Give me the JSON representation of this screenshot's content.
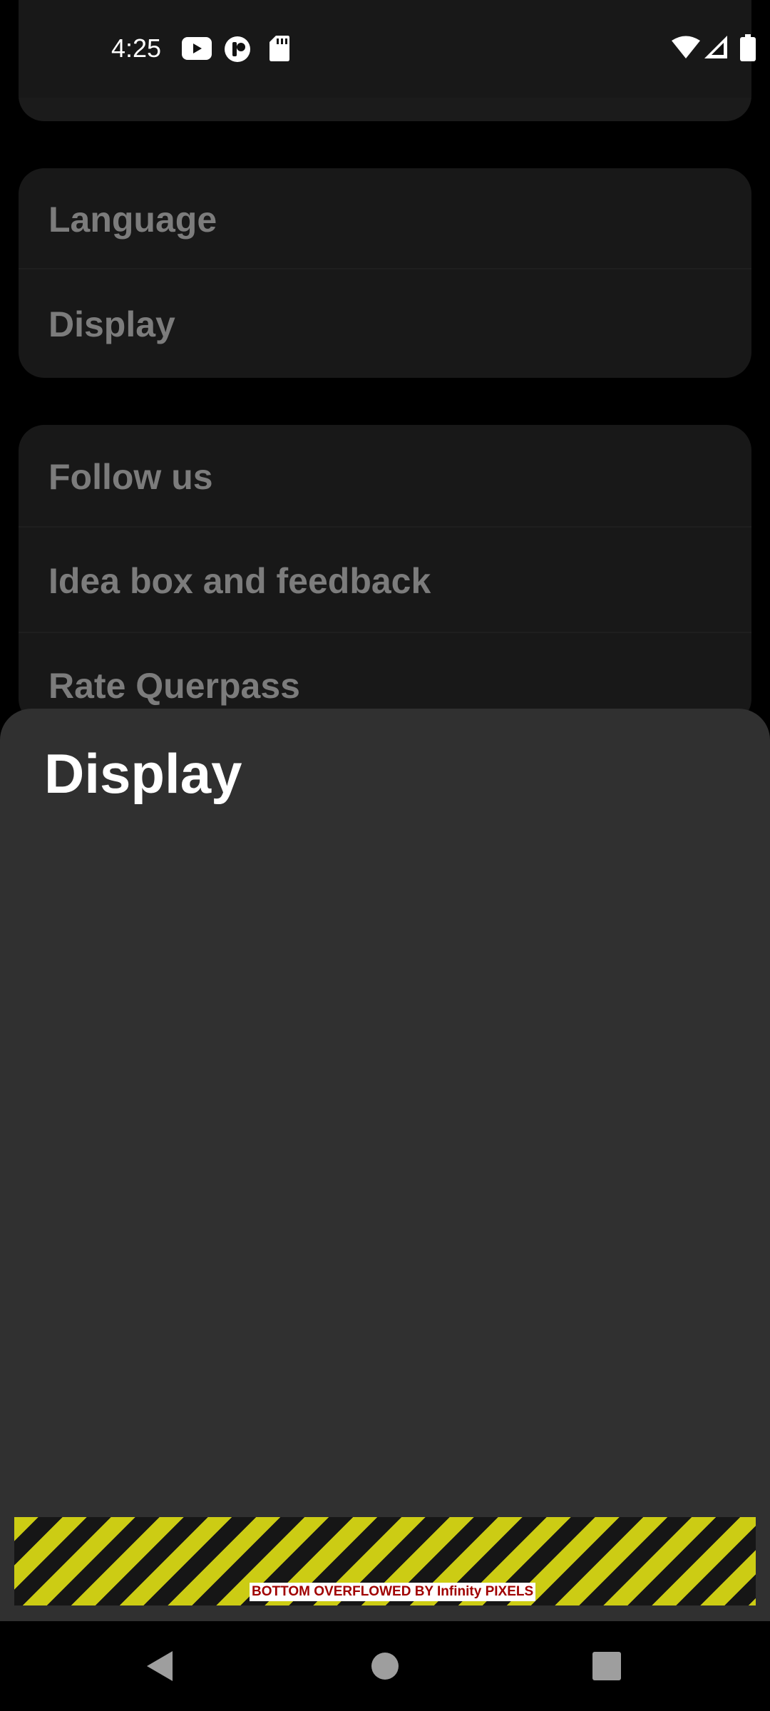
{
  "status_bar": {
    "time": "4:25",
    "left_icons": [
      "youtube-icon",
      "app-notification-icon",
      "sd-card-icon"
    ],
    "right_icons": [
      "wifi-icon",
      "cellular-signal-icon",
      "battery-icon"
    ]
  },
  "settings": {
    "group_general": {
      "items": [
        {
          "label": "Language"
        },
        {
          "label": "Display"
        }
      ]
    },
    "group_community": {
      "items": [
        {
          "label": "Follow us"
        },
        {
          "label": "Idea box and feedback"
        },
        {
          "label": "Rate Querpass"
        }
      ]
    }
  },
  "sheet": {
    "title": "Display",
    "overflow_warning": "BOTTOM OVERFLOWED BY Infinity PIXELS"
  },
  "nav_bar": {
    "buttons": [
      "back-icon",
      "home-icon",
      "recents-icon"
    ]
  },
  "colors": {
    "background": "#000000",
    "card": "#181818",
    "sheet": "#303030",
    "muted_text": "#7c7c7c",
    "stripe_yellow": "#cccc14",
    "warning_text": "#a00000"
  }
}
